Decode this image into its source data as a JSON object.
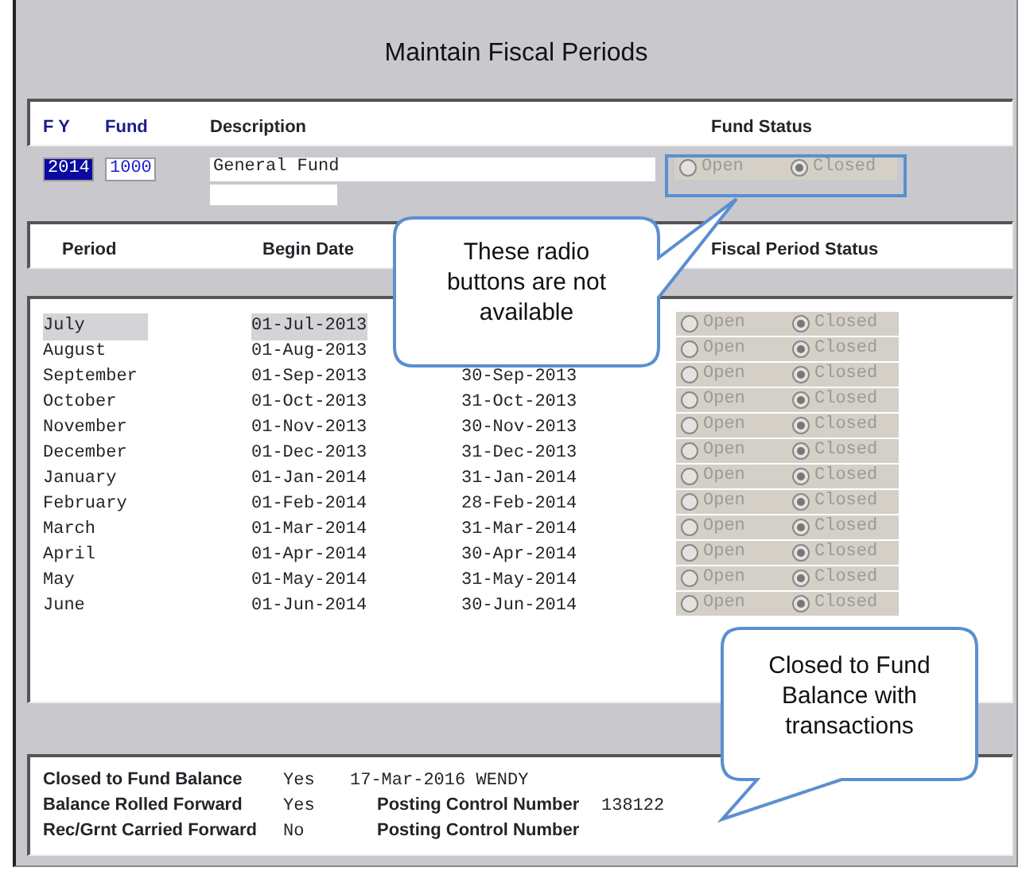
{
  "window": {
    "title": "Maintain Fiscal Periods"
  },
  "fund_header": [
    {
      "label": "F Y",
      "kind": "key"
    },
    {
      "label": "Fund",
      "kind": "key"
    },
    {
      "label": "Description",
      "kind": "plain"
    },
    {
      "label": "Fund Status",
      "kind": "plain"
    }
  ],
  "fund": {
    "fy": "2014",
    "fy_selected": true,
    "fund": "1000",
    "description": "General Fund",
    "status_disabled": true,
    "status_options": [
      {
        "label": "Open",
        "selected": false
      },
      {
        "label": "Closed",
        "selected": true
      }
    ]
  },
  "period_header": [
    "Period",
    "Begin Date",
    "Fiscal Period Status"
  ],
  "periods": [
    {
      "period": "July",
      "begin": "01-Jul-2013",
      "selected": true,
      "status_disabled": true,
      "status_options": [
        {
          "label": "Open",
          "selected": false
        },
        {
          "label": "Closed",
          "selected": true
        }
      ]
    },
    {
      "period": "August",
      "begin": "01-Aug-2013",
      "selected": false,
      "status_disabled": true,
      "status_options": [
        {
          "label": "Open",
          "selected": false
        },
        {
          "label": "Closed",
          "selected": true
        }
      ]
    },
    {
      "period": "September",
      "begin": "01-Sep-2013",
      "end": "30-Sep-2013",
      "selected": false,
      "status_disabled": true,
      "status_options": [
        {
          "label": "Open",
          "selected": false
        },
        {
          "label": "Closed",
          "selected": true
        }
      ]
    },
    {
      "period": "October",
      "begin": "01-Oct-2013",
      "end": "31-Oct-2013",
      "selected": false,
      "status_disabled": true,
      "status_options": [
        {
          "label": "Open",
          "selected": false
        },
        {
          "label": "Closed",
          "selected": true
        }
      ]
    },
    {
      "period": "November",
      "begin": "01-Nov-2013",
      "end": "30-Nov-2013",
      "selected": false,
      "status_disabled": true,
      "status_options": [
        {
          "label": "Open",
          "selected": false
        },
        {
          "label": "Closed",
          "selected": true
        }
      ]
    },
    {
      "period": "December",
      "begin": "01-Dec-2013",
      "end": "31-Dec-2013",
      "selected": false,
      "status_disabled": true,
      "status_options": [
        {
          "label": "Open",
          "selected": false
        },
        {
          "label": "Closed",
          "selected": true
        }
      ]
    },
    {
      "period": "January",
      "begin": "01-Jan-2014",
      "end": "31-Jan-2014",
      "selected": false,
      "status_disabled": true,
      "status_options": [
        {
          "label": "Open",
          "selected": false
        },
        {
          "label": "Closed",
          "selected": true
        }
      ]
    },
    {
      "period": "February",
      "begin": "01-Feb-2014",
      "end": "28-Feb-2014",
      "selected": false,
      "status_disabled": true,
      "status_options": [
        {
          "label": "Open",
          "selected": false
        },
        {
          "label": "Closed",
          "selected": true
        }
      ]
    },
    {
      "period": "March",
      "begin": "01-Mar-2014",
      "end": "31-Mar-2014",
      "selected": false,
      "status_disabled": true,
      "status_options": [
        {
          "label": "Open",
          "selected": false
        },
        {
          "label": "Closed",
          "selected": true
        }
      ]
    },
    {
      "period": "April",
      "begin": "01-Apr-2014",
      "end": "30-Apr-2014",
      "selected": false,
      "status_disabled": true,
      "status_options": [
        {
          "label": "Open",
          "selected": false
        },
        {
          "label": "Closed",
          "selected": true
        }
      ]
    },
    {
      "period": "May",
      "begin": "01-May-2014",
      "end": "31-May-2014",
      "selected": false,
      "status_disabled": true,
      "status_options": [
        {
          "label": "Open",
          "selected": false
        },
        {
          "label": "Closed",
          "selected": true
        }
      ]
    },
    {
      "period": "June",
      "begin": "01-Jun-2014",
      "end": "30-Jun-2014",
      "selected": false,
      "status_disabled": true,
      "status_options": [
        {
          "label": "Open",
          "selected": false
        },
        {
          "label": "Closed",
          "selected": true
        }
      ]
    }
  ],
  "summary": [
    {
      "label": "Closed to Fund Balance",
      "value": "Yes",
      "detail": "17-Mar-2016 WENDY"
    },
    {
      "label": "Balance Rolled Forward",
      "value": "Yes",
      "posting_label": "Posting Control Number",
      "posting_number": "138122"
    },
    {
      "label": "Rec/Grnt Carried Forward",
      "value": "No",
      "posting_label": "Posting Control Number"
    }
  ],
  "callouts": [
    "These radio buttons are not available",
    "Closed to Fund Balance with transactions"
  ]
}
